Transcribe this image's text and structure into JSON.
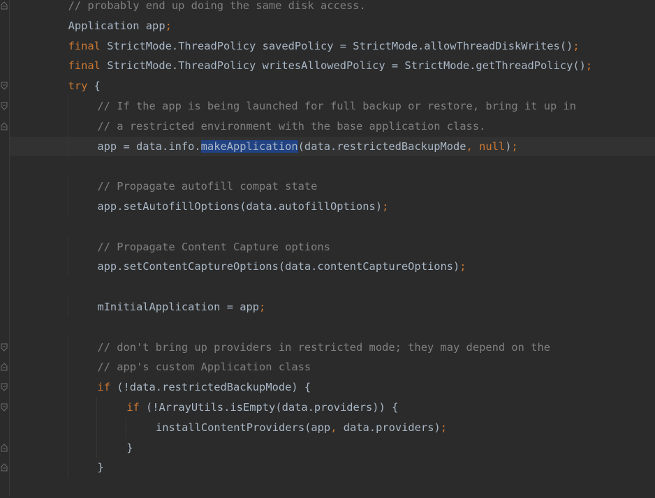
{
  "theme": {
    "background": "#2b2b2b",
    "keyword": "#cc7832",
    "comment": "#808080",
    "identifier": "#a9b7c6",
    "selection": "#214283",
    "current_line": "#323232"
  },
  "code": {
    "lines": [
      {
        "indent": 2,
        "tokens": [
          [
            "cm",
            "// probably end up doing the same disk access."
          ]
        ]
      },
      {
        "indent": 2,
        "tokens": [
          [
            "id",
            "Application app"
          ],
          [
            "pun",
            ";"
          ]
        ]
      },
      {
        "indent": 2,
        "tokens": [
          [
            "kw",
            "final "
          ],
          [
            "id",
            "StrictMode.ThreadPolicy savedPolicy = StrictMode.allowThreadDiskWrites()"
          ],
          [
            "pun",
            ";"
          ]
        ]
      },
      {
        "indent": 2,
        "tokens": [
          [
            "kw",
            "final "
          ],
          [
            "id",
            "StrictMode.ThreadPolicy writesAllowedPolicy = StrictMode.getThreadPolicy()"
          ],
          [
            "pun",
            ";"
          ]
        ]
      },
      {
        "indent": 2,
        "tokens": [
          [
            "kw",
            "try "
          ],
          [
            "id",
            "{"
          ]
        ]
      },
      {
        "indent": 3,
        "tokens": [
          [
            "cm",
            "// If the app is being launched for full backup or restore, bring it up in"
          ]
        ]
      },
      {
        "indent": 3,
        "tokens": [
          [
            "cm",
            "// a restricted environment with the base application class."
          ]
        ]
      },
      {
        "indent": 3,
        "current": true,
        "tokens": [
          [
            "id",
            "app = data.info."
          ],
          [
            "sel",
            "makeApplication"
          ],
          [
            "id",
            "(data.restrictedBackupMode"
          ],
          [
            "pun",
            ", "
          ],
          [
            "kw",
            "null"
          ],
          [
            "id",
            ")"
          ],
          [
            "pun",
            ";"
          ]
        ]
      },
      {
        "indent": 0,
        "tokens": []
      },
      {
        "indent": 3,
        "tokens": [
          [
            "cm",
            "// Propagate autofill compat state"
          ]
        ]
      },
      {
        "indent": 3,
        "tokens": [
          [
            "id",
            "app.setAutofillOptions(data.autofillOptions)"
          ],
          [
            "pun",
            ";"
          ]
        ]
      },
      {
        "indent": 0,
        "tokens": []
      },
      {
        "indent": 3,
        "tokens": [
          [
            "cm",
            "// Propagate Content Capture options"
          ]
        ]
      },
      {
        "indent": 3,
        "tokens": [
          [
            "id",
            "app.setContentCaptureOptions(data.contentCaptureOptions)"
          ],
          [
            "pun",
            ";"
          ]
        ]
      },
      {
        "indent": 0,
        "tokens": []
      },
      {
        "indent": 3,
        "tokens": [
          [
            "id",
            "mInitialApplication = app"
          ],
          [
            "pun",
            ";"
          ]
        ]
      },
      {
        "indent": 0,
        "tokens": []
      },
      {
        "indent": 3,
        "tokens": [
          [
            "cm",
            "// don't bring up providers in restricted mode; they may depend on the"
          ]
        ]
      },
      {
        "indent": 3,
        "tokens": [
          [
            "cm",
            "// app's custom Application class"
          ]
        ]
      },
      {
        "indent": 3,
        "tokens": [
          [
            "kw",
            "if "
          ],
          [
            "id",
            "(!data.restrictedBackupMode) {"
          ]
        ]
      },
      {
        "indent": 4,
        "tokens": [
          [
            "kw",
            "if "
          ],
          [
            "id",
            "(!ArrayUtils.isEmpty(data.providers)) {"
          ]
        ]
      },
      {
        "indent": 5,
        "tokens": [
          [
            "id",
            "installContentProviders(app"
          ],
          [
            "pun",
            ", "
          ],
          [
            "id",
            "data.providers)"
          ],
          [
            "pun",
            ";"
          ]
        ]
      },
      {
        "indent": 4,
        "tokens": [
          [
            "id",
            "}"
          ]
        ]
      },
      {
        "indent": 3,
        "tokens": [
          [
            "id",
            "}"
          ]
        ]
      },
      {
        "indent": 0,
        "tokens": []
      }
    ]
  },
  "gutter": {
    "fold_markers": [
      {
        "line": 0,
        "icon": "fold-end-icon"
      },
      {
        "line": 4,
        "icon": "fold-start-icon"
      },
      {
        "line": 5,
        "icon": "fold-start-icon"
      },
      {
        "line": 6,
        "icon": "fold-end-icon"
      },
      {
        "line": 17,
        "icon": "fold-start-icon"
      },
      {
        "line": 18,
        "icon": "fold-end-icon"
      },
      {
        "line": 19,
        "icon": "fold-start-icon"
      },
      {
        "line": 20,
        "icon": "fold-start-icon"
      },
      {
        "line": 22,
        "icon": "fold-end-icon"
      },
      {
        "line": 23,
        "icon": "fold-end-icon"
      }
    ]
  }
}
